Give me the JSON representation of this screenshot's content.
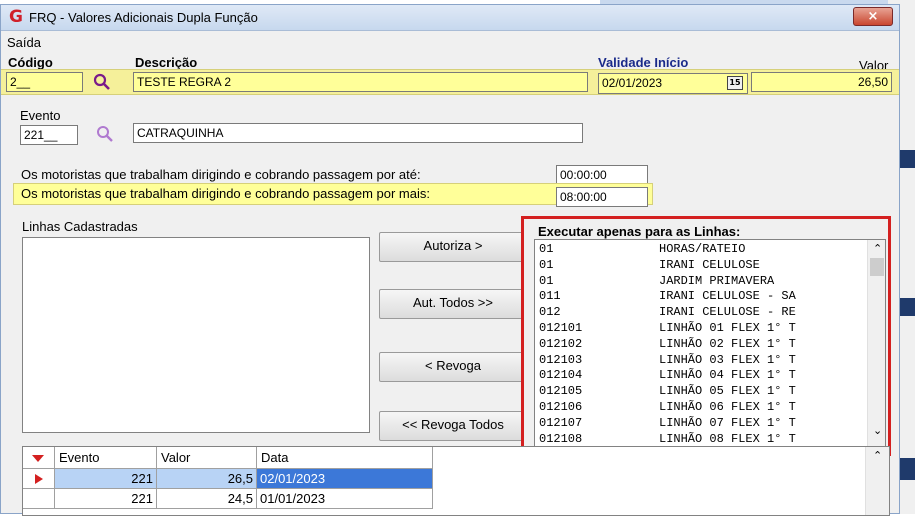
{
  "window": {
    "title": "FRQ - Valores Adicionais Dupla Função",
    "close_glyph": "×"
  },
  "menu": {
    "saida": "Saída"
  },
  "header": {
    "codigo_label": "Código",
    "descricao_label": "Descrição",
    "validade_label": "Validade Início",
    "valor_label": "Valor",
    "codigo_value": "2__",
    "descricao_value": "TESTE REGRA 2",
    "validade_value": "02/01/2023",
    "valor_value": "26,50"
  },
  "evento": {
    "label": "Evento",
    "code": "221__",
    "description": "CATRAQUINHA"
  },
  "motoristas": {
    "ate_label": "Os motoristas que trabalham dirigindo e cobrando passagem por até:",
    "ate_value": "00:00:00",
    "mais_label": "Os motoristas que trabalham dirigindo e cobrando passagem por mais:",
    "mais_value": "08:00:00"
  },
  "linhas_cadastradas": {
    "label": "Linhas Cadastradas",
    "items": []
  },
  "buttons": {
    "autoriza": "Autoriza >",
    "aut_todos": "Aut. Todos >>",
    "revoga": "< Revoga",
    "revoga_todos": "<< Revoga Todos"
  },
  "executar": {
    "title": "Executar apenas para as Linhas:",
    "rows": [
      {
        "code": "01",
        "name": "HORAS/RATEIO"
      },
      {
        "code": "01",
        "name": "IRANI CELULOSE"
      },
      {
        "code": "01",
        "name": "JARDIM PRIMAVERA"
      },
      {
        "code": "011",
        "name": "IRANI CELULOSE - SA"
      },
      {
        "code": "012",
        "name": "IRANI CELULOSE - RE"
      },
      {
        "code": "012101",
        "name": "LINHÃO 01 FLEX 1° T"
      },
      {
        "code": "012102",
        "name": "LINHÃO 02 FLEX 1° T"
      },
      {
        "code": "012103",
        "name": "LINHÃO 03 FLEX 1° T"
      },
      {
        "code": "012104",
        "name": "LINHÃO 04 FLEX 1° T"
      },
      {
        "code": "012105",
        "name": "LINHÃO 05 FLEX 1° T"
      },
      {
        "code": "012106",
        "name": "LINHÃO 06 FLEX 1° T"
      },
      {
        "code": "012107",
        "name": "LINHÃO 07 FLEX 1° T"
      },
      {
        "code": "012108",
        "name": "LINHÃO 08 FLEX 1° T"
      }
    ]
  },
  "grid": {
    "headers": [
      "Evento",
      "Valor",
      "Data"
    ],
    "rows": [
      {
        "evento": "221",
        "valor": "26,5",
        "data": "02/01/2023",
        "selected": true
      },
      {
        "evento": "221",
        "valor": "24,5",
        "data": "01/01/2023",
        "selected": false
      }
    ]
  },
  "colors": {
    "highlight_yellow": "#ffff99",
    "selection_blue": "#3c78d8",
    "red_box": "#d42020"
  }
}
